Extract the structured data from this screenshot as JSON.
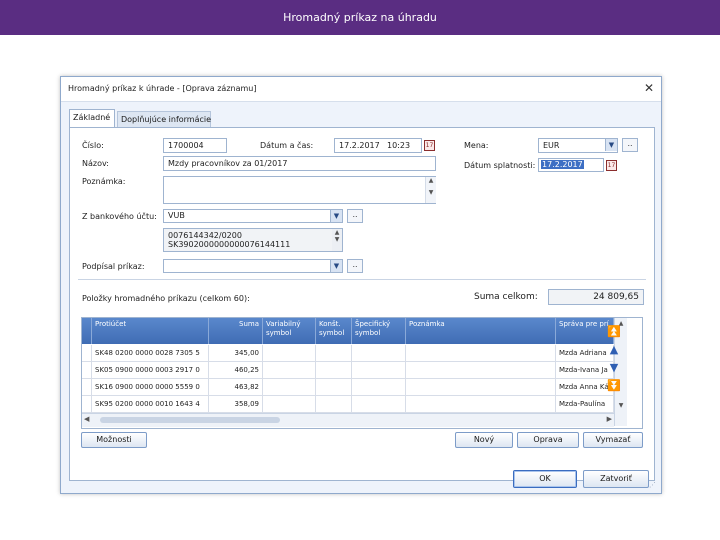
{
  "slide_title": "Hromadný príkaz na úhradu",
  "dialog": {
    "title": "Hromadný príkaz k úhrade - [Oprava záznamu]",
    "tabs": [
      "Základné",
      "Doplňujúce informácie"
    ]
  },
  "form": {
    "cislo_label": "Číslo:",
    "cislo_value": "1700004",
    "datum_cas_label": "Dátum a čas:",
    "datum_value": "17.2.2017",
    "cas_value": "10:23",
    "mena_label": "Mena:",
    "mena_value": "EUR",
    "nazov_label": "Názov:",
    "nazov_value": "Mzdy pracovníkov za 01/2017",
    "datum_splatnosti_label": "Dátum splatnosti:",
    "datum_splatnosti_value": "17.2.2017",
    "poznamka_label": "Poznámka:",
    "poznamka_value": "",
    "z_bankoveho_uctu_label": "Z bankového účtu:",
    "bank_value": "VUB",
    "account_line1": "0076144342/0200",
    "account_line2": "SK3902000000000076144111",
    "podpisal_label": "Podpísal príkaz:",
    "podpisal_value": "",
    "dots": ".."
  },
  "items": {
    "header_label": "Položky hromadného príkazu (celkom 60):",
    "sum_label": "Suma celkom:",
    "sum_value": "24 809,65",
    "columns": [
      "Protiúčet",
      "Suma",
      "Variabilný symbol",
      "Konšt. symbol",
      "Špecifický symbol",
      "Poznámka",
      "Správa pre prí"
    ],
    "rows": [
      {
        "account": "SK48 0200 0000 0028 7305 5",
        "amount": "345,00",
        "var": "",
        "konst": "",
        "spec": "",
        "note": "",
        "msg": "Mzda Adriana"
      },
      {
        "account": "SK05 0900 0000 0003 2917 0",
        "amount": "460,25",
        "var": "",
        "konst": "",
        "spec": "",
        "note": "",
        "msg": "Mzda-Ivana Ja"
      },
      {
        "account": "SK16 0900 0000 0000 5559 0",
        "amount": "463,82",
        "var": "",
        "konst": "",
        "spec": "",
        "note": "",
        "msg": "Mzda Anna Ká"
      },
      {
        "account": "SK95 0200 0000 0010 1643 4",
        "amount": "358,09",
        "var": "",
        "konst": "",
        "spec": "",
        "note": "",
        "msg": "Mzda-Paulína"
      }
    ]
  },
  "buttons": {
    "moznosti": "Možnosti",
    "novy": "Nový",
    "oprava": "Oprava",
    "vymazat": "Vymazať",
    "ok": "OK",
    "zatvorit": "Zatvoriť"
  },
  "colors": {
    "topbar": "#5a2d82",
    "grid_header": "#4a78c0",
    "window_bg": "#eef3fb"
  }
}
